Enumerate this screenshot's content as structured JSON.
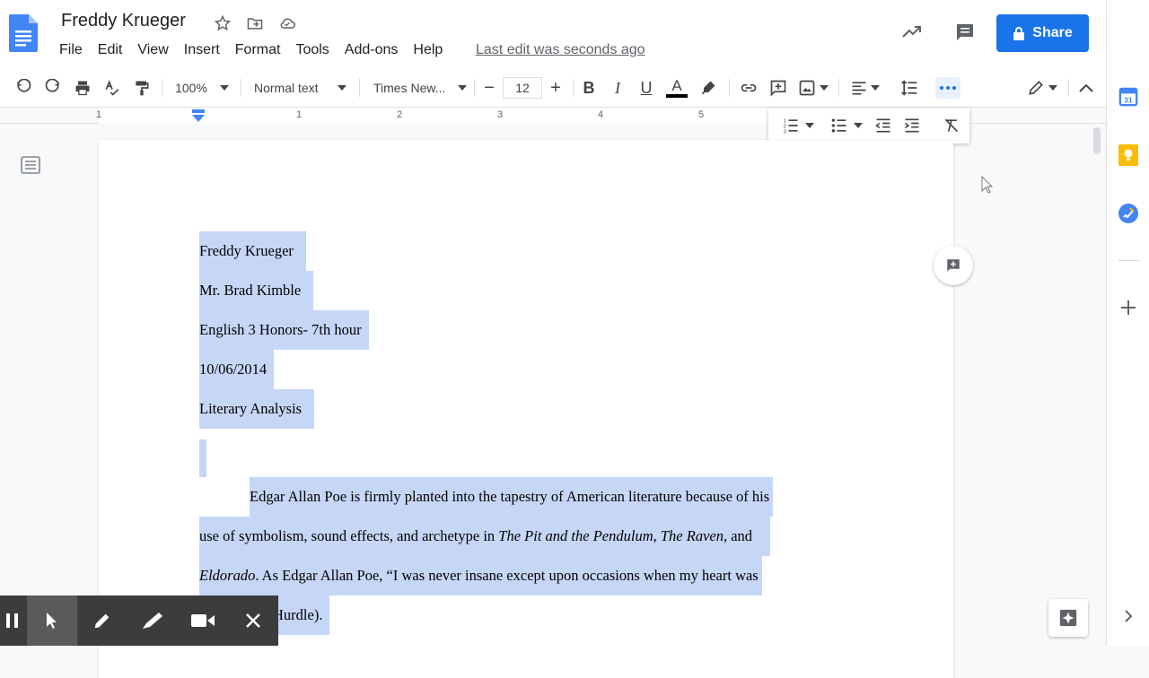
{
  "header": {
    "doc_title": "Freddy Krueger",
    "menus": [
      "File",
      "Edit",
      "View",
      "Insert",
      "Format",
      "Tools",
      "Add-ons",
      "Help"
    ],
    "last_edit": "Last edit was seconds ago",
    "share_label": "Share"
  },
  "toolbar": {
    "zoom": "100%",
    "style": "Normal text",
    "font": "Times New...",
    "font_size": "12",
    "minus": "−",
    "plus": "+"
  },
  "ruler": {
    "numbers": [
      "1",
      "1",
      "2",
      "3",
      "4",
      "5"
    ]
  },
  "document": {
    "lines": [
      "Freddy Krueger",
      "Mr. Brad Kimble",
      "English 3 Honors- 7th hour",
      "10/06/2014",
      "Literary Analysis"
    ],
    "para1": "Edgar Allan Poe is firmly planted into the tapestry of American literature because of his",
    "para2_a": "use of symbolism, sound effects, and archetype in ",
    "para2_i1": "The Pit and the Pendulum",
    "para2_b": ", ",
    "para2_i2": "The Raven",
    "para2_c": ", and",
    "para3_i": "Eldorado",
    "para3_b": ".  As Edgar Allan Poe, “I was never insane except upon occasions when my heart was",
    "para4": "Hurdle)."
  },
  "colors": {
    "accent": "#1a73e8",
    "selection": "#c6d6f7",
    "recorder_bar": "#3c3c3c"
  }
}
